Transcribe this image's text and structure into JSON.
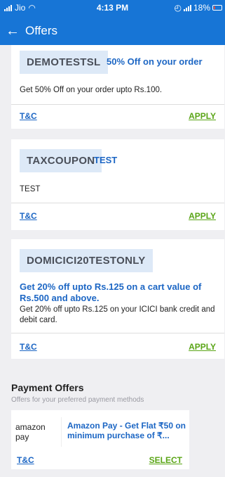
{
  "status_bar": {
    "carrier": "Jio",
    "time": "4:13 PM",
    "battery": "18%"
  },
  "header": {
    "title": "Offers",
    "back_icon": "←"
  },
  "offers": [
    {
      "code": "DEMOTESTSL",
      "title": "50% Off on your order",
      "description": "Get 50% Off on your order upto Rs.100.",
      "tc": "T&C",
      "action": "APPLY"
    },
    {
      "code": "TAXCOUPON",
      "title": "TEST",
      "description": "TEST",
      "tc": "T&C",
      "action": "APPLY"
    },
    {
      "code": "DOMICICI20TESTONLY",
      "title": "Get 20% off upto Rs.125 on a cart value of Rs.500 and above.",
      "description": "Get 20% off upto Rs.125 on your ICICI bank credit and debit card.",
      "tc": "T&C",
      "action": "APPLY"
    }
  ],
  "payment": {
    "title": "Payment Offers",
    "subtitle": "Offers for your preferred payment methods",
    "offer": {
      "logo": "amazon pay",
      "text": "Amazon Pay - Get Flat ₹50 on minimum purchase of ₹...",
      "tc": "T&C",
      "action": "SELECT"
    }
  },
  "colors": {
    "header_bg": "#1775d6",
    "link_blue": "#1c66c4",
    "apply_green": "#5aa516",
    "code_bg": "#dde9f7"
  }
}
